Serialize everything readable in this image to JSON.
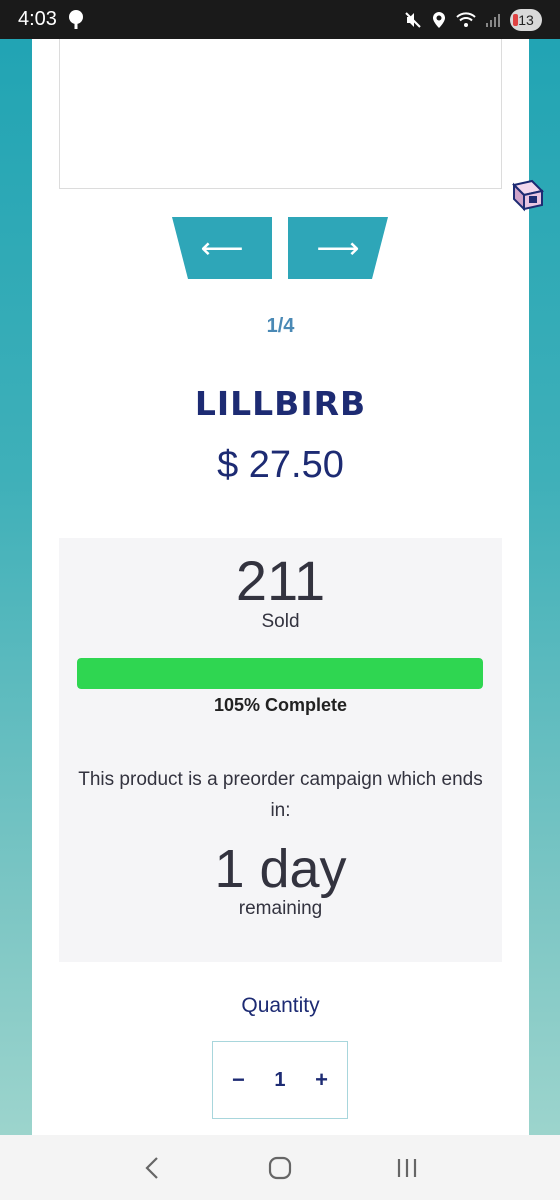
{
  "status_bar": {
    "time": "4:03",
    "notification_count": "13"
  },
  "gallery": {
    "prev_arrow": "⟵",
    "next_arrow": "⟶",
    "counter": "1/4"
  },
  "product": {
    "title": "LILLBIRB",
    "price": "$ 27.50"
  },
  "campaign": {
    "sold_count": "211",
    "sold_label": "Sold",
    "progress_percent": 100,
    "progress_text": "105% Complete",
    "preorder_text": "This product is a preorder campaign which ends in:",
    "days_count": "1 day",
    "days_label": "remaining"
  },
  "quantity": {
    "label": "Quantity",
    "minus": "−",
    "value": "1",
    "plus": "+"
  },
  "colors": {
    "accent": "#2ea6b8",
    "title": "#1d2b73",
    "progress": "#2fd651"
  }
}
